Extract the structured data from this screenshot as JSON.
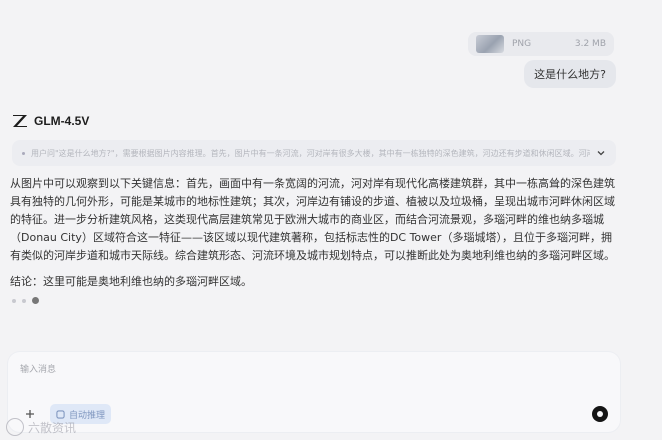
{
  "attachment": {
    "ext": "PNG",
    "size": "3.2 MB"
  },
  "user_message": "这是什么地方?",
  "model": {
    "name": "GLM-4.5V"
  },
  "thinking": {
    "summary": "用户问\"这是什么地方?\"，需要根据图片内容推理。首先，图片中有一条河流，河对岸有很多大楼，其中有一栋独特的深色建筑，河边还有步道和休闲区域。河岸的高建筑..."
  },
  "answer": {
    "paragraph": "从图片中可以观察到以下关键信息：首先，画面中有一条宽阔的河流，河对岸有现代化高楼建筑群，其中一栋高耸的深色建筑具有独特的几何外形，可能是某城市的地标性建筑；其次，河岸边有铺设的步道、植被以及垃圾桶，呈现出城市河畔休闲区域的特征。进一步分析建筑风格，这类现代高层建筑常见于欧洲大城市的商业区，而结合河流景观，多瑙河畔的维也纳多瑙城（Donau City）区域符合这一特征——该区域以现代建筑著称，包括标志性的DC Tower（多瑙城塔），且位于多瑙河畔，拥有类似的河岸步道和城市天际线。综合建筑形态、河流环境及城市规划特点，可以推断此处为奥地利维也纳的多瑙河畔区域。",
    "conclusion": "结论：这里可能是奥地利维也纳的多瑙河畔区域。"
  },
  "input": {
    "placeholder": "输入消息",
    "chip_label": "自动推理"
  },
  "watermark": "六散资讯"
}
